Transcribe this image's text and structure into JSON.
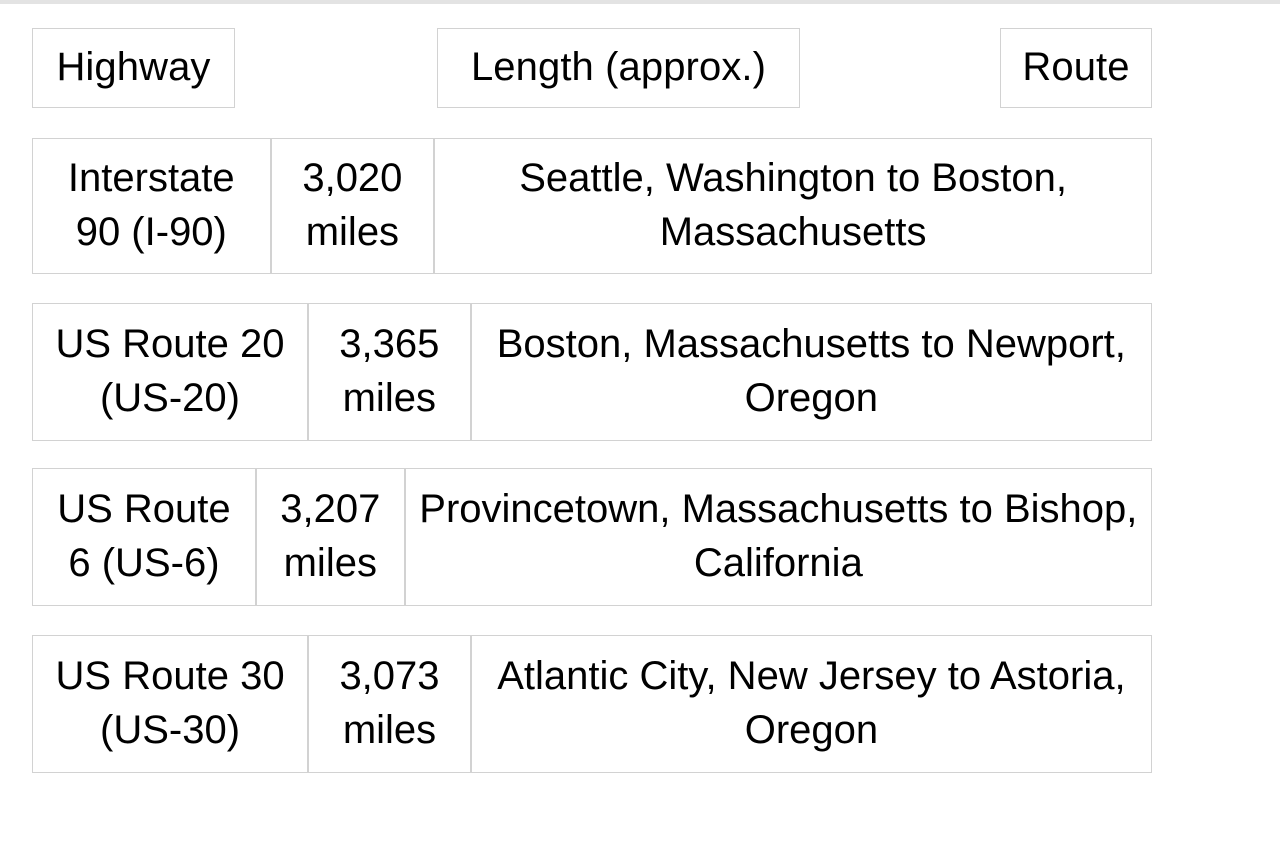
{
  "table": {
    "headers": [
      {
        "label": "Highway"
      },
      {
        "label": "Length (approx.)"
      },
      {
        "label": "Route"
      }
    ],
    "rows": [
      {
        "highway": "Interstate 90 (I-90)",
        "length": "3,020 miles",
        "route": "Seattle, Washington to Boston, Massachusetts"
      },
      {
        "highway": "US Route 20 (US-20)",
        "length": "3,365 miles",
        "route": "Boston, Massachusetts to Newport, Oregon"
      },
      {
        "highway": "US Route 6 (US-6)",
        "length": "3,207 miles",
        "route": "Provincetown, Massachusetts to Bishop, California"
      },
      {
        "highway": "US Route 30 (US-30)",
        "length": "3,073 miles",
        "route": "Atlantic City, New Jersey to Astoria, Oregon"
      }
    ]
  },
  "colors": {
    "border": "#d2d2d2",
    "top_rule": "#e3e3e3",
    "text": "#000000",
    "background": "#ffffff"
  }
}
